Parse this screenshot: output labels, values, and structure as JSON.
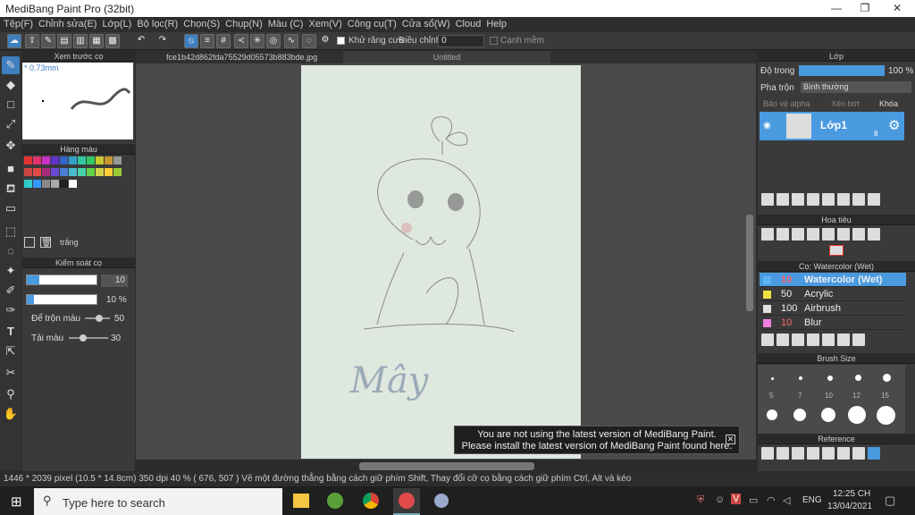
{
  "app": {
    "title": "MediBang Paint Pro (32bit)"
  },
  "window_controls": {
    "minimize": "—",
    "maximize": "❐",
    "close": "✕"
  },
  "menu": [
    "Tệp(F)",
    "Chỉnh sửa(E)",
    "Lớp(L)",
    "Bộ lọc(R)",
    "Chọn(S)",
    "Chụp(N)",
    "Màu (C)",
    "Xem(V)",
    "Công cụ(T)",
    "Cửa sổ(W)",
    "Cloud",
    "Help"
  ],
  "toolbar": {
    "antialias_label": "Khử răng cưa",
    "adjust_label": "Điều chỉnh",
    "adjust_value": "0",
    "edge_label": "Cạnh mềm"
  },
  "left_panel": {
    "preview_title": "Xem trước cọ",
    "brush_size_label": "* 0.73mm",
    "palette_title": "Hàng màu",
    "palette_name": "trắng",
    "palette_colors": [
      "#e23232",
      "#e2326e",
      "#c832c8",
      "#5a32c8",
      "#3264c8",
      "#32a0c8",
      "#32c8a0",
      "#32c864",
      "#c8c832",
      "#c89632",
      "#999999",
      "#cc4444",
      "#e24a4a",
      "#aa2d7d",
      "#6a4ad2",
      "#4a7ed2",
      "#4abad2",
      "#4ad2aa",
      "#64d24a",
      "#d2d24a",
      "#ffcc33",
      "#99cc33",
      "#33cccc",
      "#3399ff",
      "#888888",
      "#aaaaaa",
      "#222222",
      "#ffffff"
    ],
    "brush_control_title": "Kiểm soát cọ",
    "size_value": "10",
    "opacity_value": "10 %",
    "blend_label": "Để trộn màu",
    "blend_value": "50",
    "reload_label": "Tải màu",
    "reload_value": "30"
  },
  "tabs": {
    "file_tab": "fce1b42d862fda75529d05573b883bde.jpg",
    "untitled_tab": "Untitled"
  },
  "canvas": {
    "handwriting": "Mây"
  },
  "notice": {
    "line1": "You are not using the latest version of MediBang Paint.",
    "line2": "Please install the latest version of MediBang Paint found here."
  },
  "layers": {
    "title": "Lớp",
    "opacity_label": "Độ trong",
    "opacity_value": "100 %",
    "blend_label": "Pha trộn",
    "blend_value": "Bình thường",
    "protect_alpha": "Bảo vệ alpha",
    "clipping": "Xén bớt",
    "lock": "Khóa",
    "layer_name": "Lớp1",
    "layer_num": "8"
  },
  "navigator": {
    "title": "Hoa tiêu"
  },
  "brushes": {
    "title": "Cọ: Watercolor (Wet)",
    "items": [
      {
        "size": "10",
        "name": "Watercolor (Wet)",
        "color": "#5ab4f0"
      },
      {
        "size": "50",
        "name": "Acrylic",
        "color": "#f0e040"
      },
      {
        "size": "100",
        "name": "Airbrush",
        "color": "#e0e0e0"
      },
      {
        "size": "10",
        "name": "Blur",
        "color": "#f080e0"
      }
    ]
  },
  "brush_size": {
    "title": "Brush Size",
    "sizes": [
      "5",
      "7",
      "10",
      "12",
      "15"
    ]
  },
  "reference": {
    "title": "Reference"
  },
  "status": {
    "text": "1446 * 2039 pixel  (10.5 * 14.8cm)  350 dpi   40 %   ( 676, 507 )   Vẽ một đường thẳng bằng cách giữ phím Shift, Thay đổi cỡ cọ bằng cách giữ phím Ctrl, Alt và kéo"
  },
  "taskbar": {
    "search_placeholder": "Type here to search",
    "lang": "ENG",
    "time": "12:25 CH",
    "date": "13/04/2021"
  }
}
